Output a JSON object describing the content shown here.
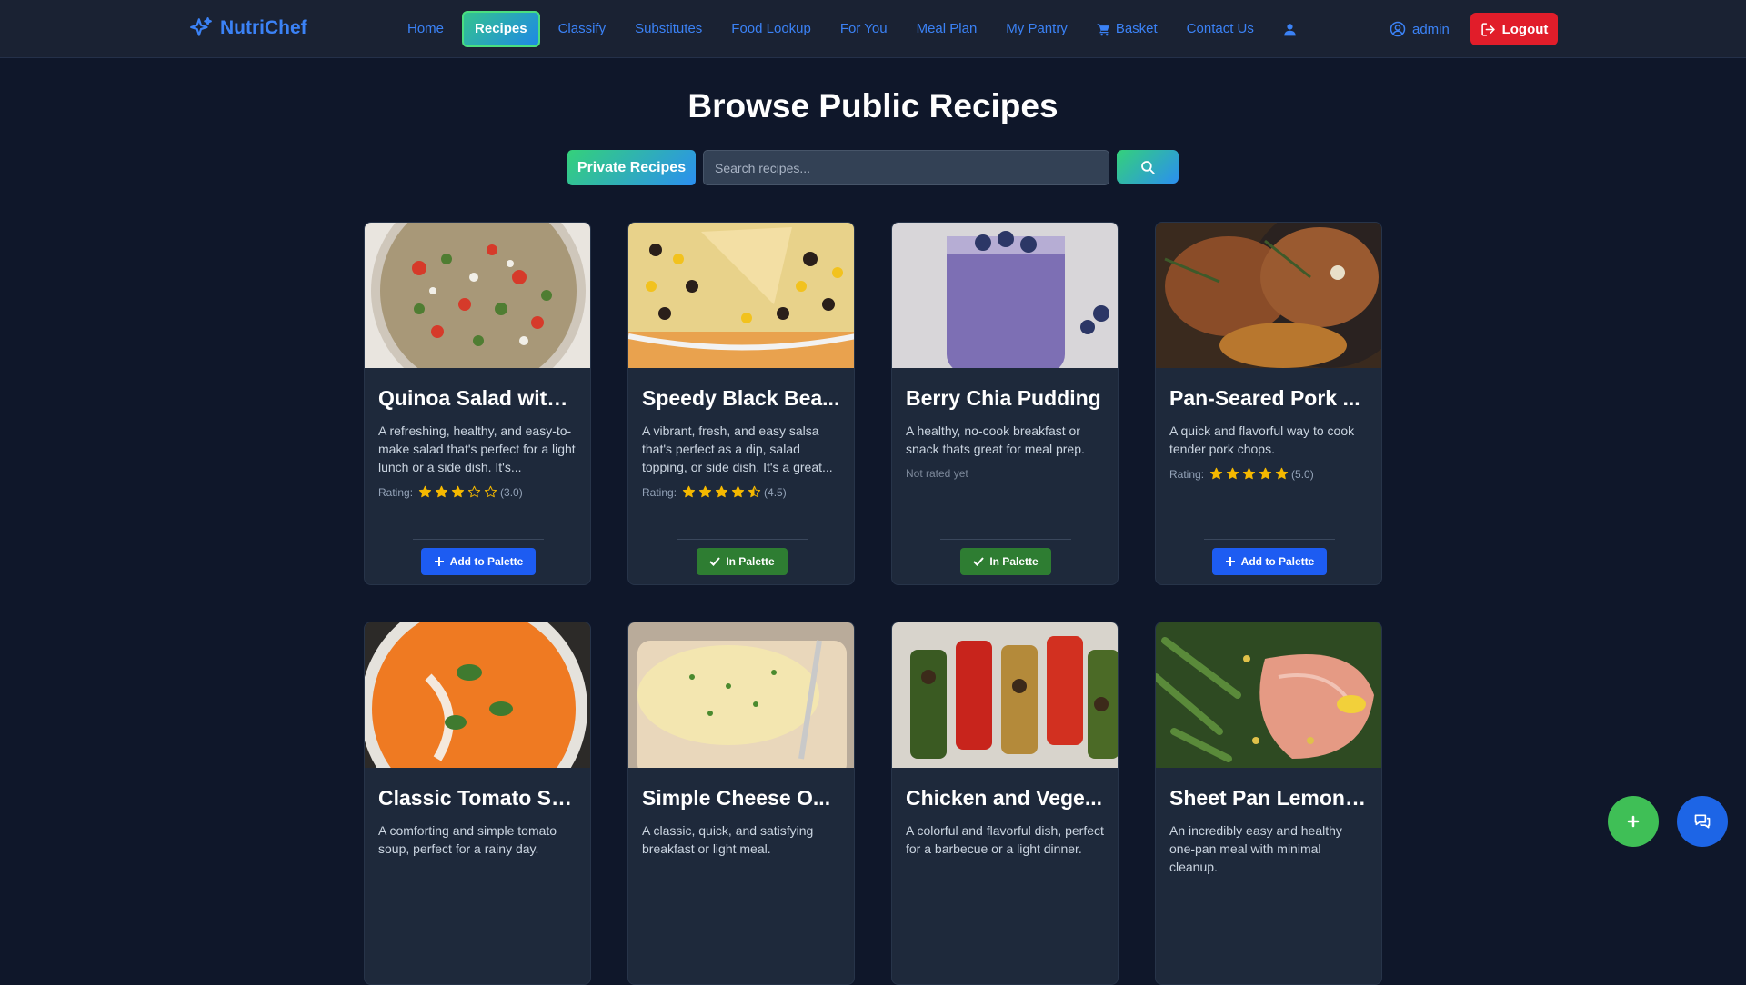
{
  "brand": {
    "name": "NutriChef"
  },
  "nav": {
    "items": [
      {
        "label": "Home"
      },
      {
        "label": "Recipes",
        "active": true
      },
      {
        "label": "Classify"
      },
      {
        "label": "Substitutes"
      },
      {
        "label": "Food Lookup"
      },
      {
        "label": "For You"
      },
      {
        "label": "Meal Plan"
      },
      {
        "label": "My Pantry"
      },
      {
        "label": "Basket",
        "icon": "cart-icon"
      },
      {
        "label": "Contact Us"
      }
    ],
    "profile_icon": "user-settings-icon",
    "user": "admin",
    "logout": "Logout"
  },
  "page": {
    "title": "Browse Public Recipes",
    "private_button": "Private Recipes",
    "search_placeholder": "Search recipes..."
  },
  "labels": {
    "rating": "Rating:",
    "not_rated": "Not rated yet",
    "add_to_palette": "Add to Palette",
    "in_palette": "In Palette"
  },
  "recipes": [
    {
      "title": "Quinoa Salad with...",
      "description": "A refreshing, healthy, and easy-to-make salad that's perfect for a light lunch or a side dish. It's...",
      "rating": 3.0,
      "rating_text": "(3.0)",
      "palette": "add",
      "image": "quinoa-salad"
    },
    {
      "title": "Speedy Black Bea...",
      "description": "A vibrant, fresh, and easy salsa that's perfect as a dip, salad topping, or side dish. It's a great...",
      "rating": 4.5,
      "rating_text": "(4.5)",
      "palette": "in",
      "image": "black-bean-salsa"
    },
    {
      "title": "Berry Chia Pudding",
      "description": "A healthy, no-cook breakfast or snack thats great for meal prep.",
      "rating": null,
      "rating_text": "",
      "palette": "in",
      "image": "chia-pudding"
    },
    {
      "title": "Pan-Seared Pork ...",
      "description": "A quick and flavorful way to cook tender pork chops.",
      "rating": 5.0,
      "rating_text": "(5.0)",
      "palette": "add",
      "image": "pork-chops"
    },
    {
      "title": "Classic Tomato So...",
      "description": "A comforting and simple tomato soup, perfect for a rainy day.",
      "image": "tomato-soup"
    },
    {
      "title": "Simple Cheese O...",
      "description": "A classic, quick, and satisfying breakfast or light meal.",
      "image": "cheese-omelette"
    },
    {
      "title": "Chicken and Vege...",
      "description": "A colorful and flavorful dish, perfect for a barbecue or a light dinner.",
      "image": "chicken-skewers"
    },
    {
      "title": "Sheet Pan Lemon ...",
      "description": "An incredibly easy and healthy one-pan meal with minimal cleanup.",
      "image": "lemon-salmon"
    }
  ],
  "colors": {
    "background": "#0f172a",
    "card": "#1e293b",
    "accent": "#3b82f6",
    "star": "#f5b800",
    "logout": "#e11d2a"
  },
  "fab": {
    "add_icon": "plus-icon",
    "chat_icon": "chat-icon"
  }
}
